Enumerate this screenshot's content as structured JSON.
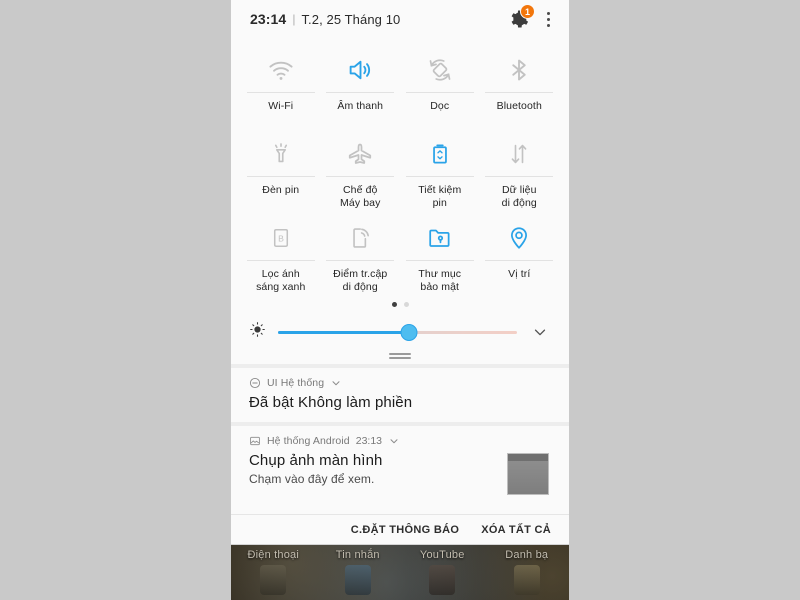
{
  "statusbar": {
    "time": "23:14",
    "separator": "|",
    "date": "T.2, 25 Tháng 10",
    "gear_icon": "gear-icon",
    "gear_badge": "1",
    "overflow_icon": "kebab-menu-icon",
    "badge_color": "#f2760c"
  },
  "quick_settings": {
    "active_color": "#2aa3e8",
    "inactive_color": "#bdbdbd",
    "tiles": [
      {
        "label": "Wi-Fi",
        "icon": "wifi-icon",
        "active": false
      },
      {
        "label": "Âm thanh",
        "icon": "volume-icon",
        "active": true
      },
      {
        "label": "Dọc",
        "icon": "auto-rotate-icon",
        "active": false
      },
      {
        "label": "Bluetooth",
        "icon": "bluetooth-icon",
        "active": false
      },
      {
        "label": "Đèn pin",
        "icon": "flashlight-icon",
        "active": false
      },
      {
        "label": "Chế độ\nMáy bay",
        "icon": "airplane-icon",
        "active": false
      },
      {
        "label": "Tiết kiệm\npin",
        "icon": "battery-saver-icon",
        "active": true
      },
      {
        "label": "Dữ liệu\ndi động",
        "icon": "mobile-data-icon",
        "active": false
      },
      {
        "label": "Lọc ánh\nsáng xanh",
        "icon": "blue-light-filter-icon",
        "active": false
      },
      {
        "label": "Điểm tr.cập\ndi động",
        "icon": "mobile-hotspot-icon",
        "active": false
      },
      {
        "label": "Thư mục\nbảo mật",
        "icon": "secure-folder-icon",
        "active": true
      },
      {
        "label": "Vị trí",
        "icon": "location-pin-icon",
        "active": true
      }
    ],
    "page_dots": {
      "count": 2,
      "active_index": 0
    }
  },
  "brightness": {
    "icon": "brightness-icon",
    "value_percent": 55,
    "expand_icon": "chevron-down-icon",
    "fill_color": "#2aa3e8",
    "drag_handle": "panel-drag-handle"
  },
  "notifications": [
    {
      "app_icon": "minus-circle-icon",
      "app_name": "UI Hệ thống",
      "time": "",
      "expand_icon": "chevron-down-icon",
      "title": "Đã bật Không làm phiền",
      "body": "",
      "has_thumbnail": false
    },
    {
      "app_icon": "image-icon",
      "app_name": "Hệ thống Android",
      "time": "23:13",
      "expand_icon": "chevron-down-icon",
      "title": "Chụp ảnh màn hình",
      "body": "Chạm vào đây để xem.",
      "has_thumbnail": true
    }
  ],
  "footer": {
    "settings_label": "C.ĐẶT THÔNG BÁO",
    "clear_all_label": "XÓA TẤT CẢ"
  },
  "dock": {
    "apps": [
      "Điện thoại",
      "Tin nhắn",
      "YouTube",
      "Danh bạ"
    ]
  }
}
